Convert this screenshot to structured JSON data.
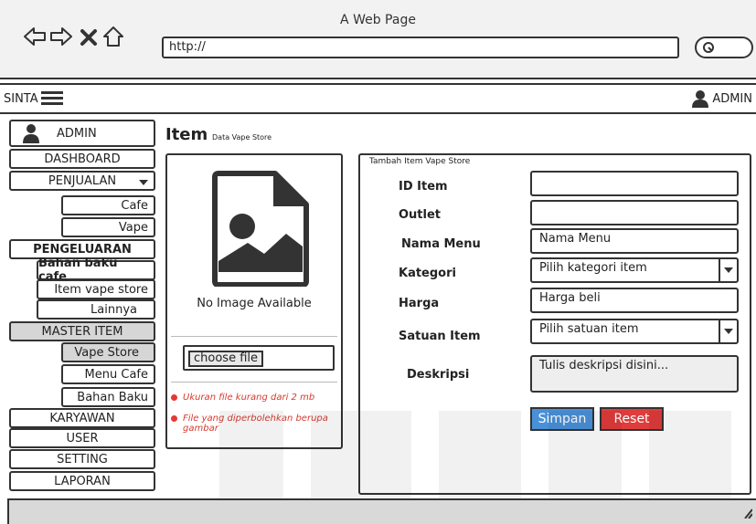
{
  "browser": {
    "title": "A Web Page",
    "address": "http://",
    "icons": [
      "back-arrow-icon",
      "forward-arrow-icon",
      "close-x-icon",
      "home-icon",
      "search-icon"
    ]
  },
  "appbar": {
    "brand": "SINTA",
    "user": "ADMIN"
  },
  "sidebar": {
    "profile": "ADMIN",
    "items": [
      {
        "label": "DASHBOARD"
      },
      {
        "label": "PENJUALAN"
      },
      {
        "label": "Cafe"
      },
      {
        "label": "Vape"
      },
      {
        "label": "PENGELUARAN"
      },
      {
        "label": "Bahan baku cafe"
      },
      {
        "label": "Item vape store"
      },
      {
        "label": "Lainnya"
      },
      {
        "label": "MASTER ITEM"
      },
      {
        "label": "Vape Store"
      },
      {
        "label": "Menu Cafe"
      },
      {
        "label": "Bahan Baku"
      },
      {
        "label": "KARYAWAN"
      },
      {
        "label": "USER"
      },
      {
        "label": "SETTING"
      },
      {
        "label": "LAPORAN"
      }
    ]
  },
  "main": {
    "title": "Item",
    "subtitle": "Data Vape Store",
    "image_panel": {
      "placeholder_text": "No Image Available",
      "choose_label": "choose file",
      "notes": [
        "Ukuran file kurang dari 2 mb",
        "File yang diperbolehkan berupa gambar"
      ]
    },
    "form": {
      "title": "Tambah Item Vape Store",
      "fields": [
        {
          "label": "ID Item",
          "value": ""
        },
        {
          "label": "Outlet",
          "value": ""
        },
        {
          "label": "Nama Menu",
          "value": "Nama Menu"
        },
        {
          "label": "Kategori",
          "value": "Pilih kategori item"
        },
        {
          "label": "Harga",
          "value": "Harga beli"
        },
        {
          "label": "Satuan Item",
          "value": "Pilih satuan item"
        },
        {
          "label": "Deskripsi",
          "value": "Tulis deskripsi disini..."
        }
      ],
      "save_label": "Simpan",
      "reset_label": "Reset"
    }
  },
  "colors": {
    "save": "#4a90d9",
    "reset": "#e03c3c",
    "note": "#d63b2f",
    "active_menu": "#d6d6d6"
  }
}
